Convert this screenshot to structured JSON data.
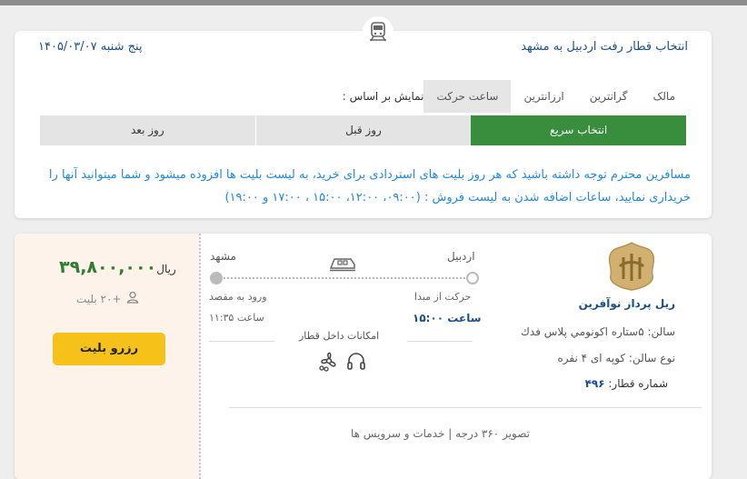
{
  "header": {
    "title": "انتخاب قطار رفت اردبیل به مشهد",
    "date": "پنج شنبه ۱۴۰۵/۰۳/۰۷"
  },
  "sort": {
    "label": "نمایش بر اساس :",
    "options": [
      "ساعت حرکت",
      "ارزانترین",
      "گرانترین",
      "مالک"
    ],
    "active_index": 0
  },
  "day_nav": {
    "quick_select": "انتخاب سریع",
    "prev_day": "روز قبل",
    "next_day": "روز بعد"
  },
  "notice": "مسافرین محترم توجه داشته باشید که هر روز بلیت های استردادی برای خرید، به لیست بلیت ها افزوده میشود و شما میتوانید آنها را خریداری نمایید، ساعات اضافه شدن به لیست فروش : (۰۹:۰۰، ۱۲:۰۰، ۱۵:۰۰ ، ۱۷:۰۰ و ۱۹:۰۰)",
  "ticket": {
    "price": "۳۹,۸۰۰,۰۰۰",
    "currency": "ریال",
    "seats": "+۲۰ بلیت",
    "book_label": "رزرو بلیت",
    "origin": "اردبیل",
    "destination": "مشهد",
    "departure_label": "حرکت از مبدا",
    "departure_time": "ساعت ۱۵:۰۰",
    "arrival_label": "ورود به مقصد",
    "arrival_time": "ساعت ۱۱:۳۵",
    "amenities_label": "امکانات داخل قطار",
    "operator": "ریل پرداز نوآفرین",
    "hall": "سالن: ۵ستاره اکونومي پلاس فدك",
    "hall_type": "نوع سالن: کوپه ای ۴ نفره",
    "train_number_label": "شماره قطار:",
    "train_number": "۴۹۶",
    "footer": "تصویر ۳۶۰ درجه | خدمات و سرویس ها"
  },
  "colors": {
    "accent_blue": "#1e88e5",
    "title_blue": "#1a4f8b",
    "active_green": "#388e3c",
    "price_green": "#2e7d32",
    "button_yellow": "#f6c21a"
  }
}
